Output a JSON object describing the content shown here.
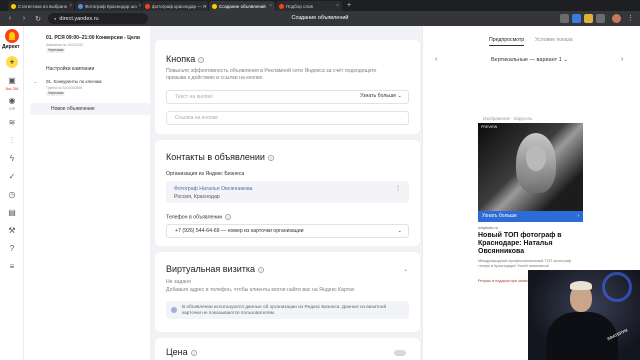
{
  "browser": {
    "tabs": [
      {
        "label": "Статистика по выбранн",
        "favicon_color": "#ffcc00",
        "active": false
      },
      {
        "label": "Фотограф Краснодар шо",
        "favicon_color": "#4a90e2",
        "active": false
      },
      {
        "label": "фотограф краснодар — Я",
        "favicon_color": "#fc3f1d",
        "active": false
      },
      {
        "label": "Создание объявлений",
        "favicon_color": "#ffcc00",
        "active": true
      },
      {
        "label": "Подбор слов",
        "favicon_color": "#fc3f1d",
        "active": false
      }
    ],
    "new_tab": "+",
    "url": "direct.yandex.ru",
    "page_title": "Создание объявлений",
    "nav": {
      "back": "‹",
      "forward": "›",
      "reload": "↻"
    }
  },
  "rail": {
    "logo_text": "Директ",
    "add": "+",
    "badge1": "Вас 256",
    "badge2": "0 ₽"
  },
  "tree": {
    "campaign_name": "01. РСЯ 09:00–21:00 Конверсии - Цели",
    "campaign_meta": "Кампания № 00222032",
    "campaign_status": "Черновик",
    "settings_label": "Настройки кампании",
    "group_name": "01. Конкуренты по ключам",
    "group_meta": "Группа № 5200030895",
    "group_status": "Черновик",
    "new_ad": "Новое объявление",
    "collapse": "–"
  },
  "button_section": {
    "title": "Кнопка",
    "help": "?",
    "description": "Повысьте эффективность объявления в Рекламной сети Яндекса за счёт подходящего призыва к действию и ссылки на кнопке.",
    "text_placeholder": "Текст на кнопке",
    "action_value": "Узнать больше",
    "link_placeholder": "Ссылка на кнопке"
  },
  "contacts_section": {
    "title": "Контакты в объявлении",
    "help": "?",
    "org_label": "Организация из Яндекс Бизнеса",
    "org_name": "Фотограф Наталья Овсянникова",
    "org_city": "Россия, Краснодар",
    "dots": "⋮",
    "phone_label": "Телефон в объявлении",
    "phone_value": "+7 (926) 544-64-69 — номер из карточки организации"
  },
  "vcard_section": {
    "title": "Виртуальная визитка",
    "help": "?",
    "status": "Не задано",
    "description": "Добавьте адрес и телефон, чтобы клиенты могли найти вас на Яндекс Картах",
    "info_text": "В объявлении используются данные об организации из Яндекс Бизнеса. Данные из визитной карточки не показываются пользователям."
  },
  "price_section": {
    "title": "Цена",
    "help": "?"
  },
  "preview": {
    "tab_preview": "Предпросмотр",
    "tab_terms": "Условие показа",
    "variant": "Вертикальные — вариант 1",
    "variant_arrow": "⌄",
    "prev": "‹",
    "next": "›",
    "image_caption": "Изображение · Карусель",
    "brand_overlay": "PREVIEW",
    "button_label": "Узнать больше",
    "button_arrow": "›",
    "domain": "ovsphoto.ru",
    "ad_title": "Новый ТОП фотограф в Краснодаре: Наталья Овсянникова",
    "ad_text": "Международный профессиональный ТОП фотограф теперь в Краснодаре! Успей записаться!",
    "ad_promo": "Ретушь в подарок при записи до 20 сентября"
  },
  "webcam": {
    "shirt_text": "ЭФАТЕРУМ"
  }
}
